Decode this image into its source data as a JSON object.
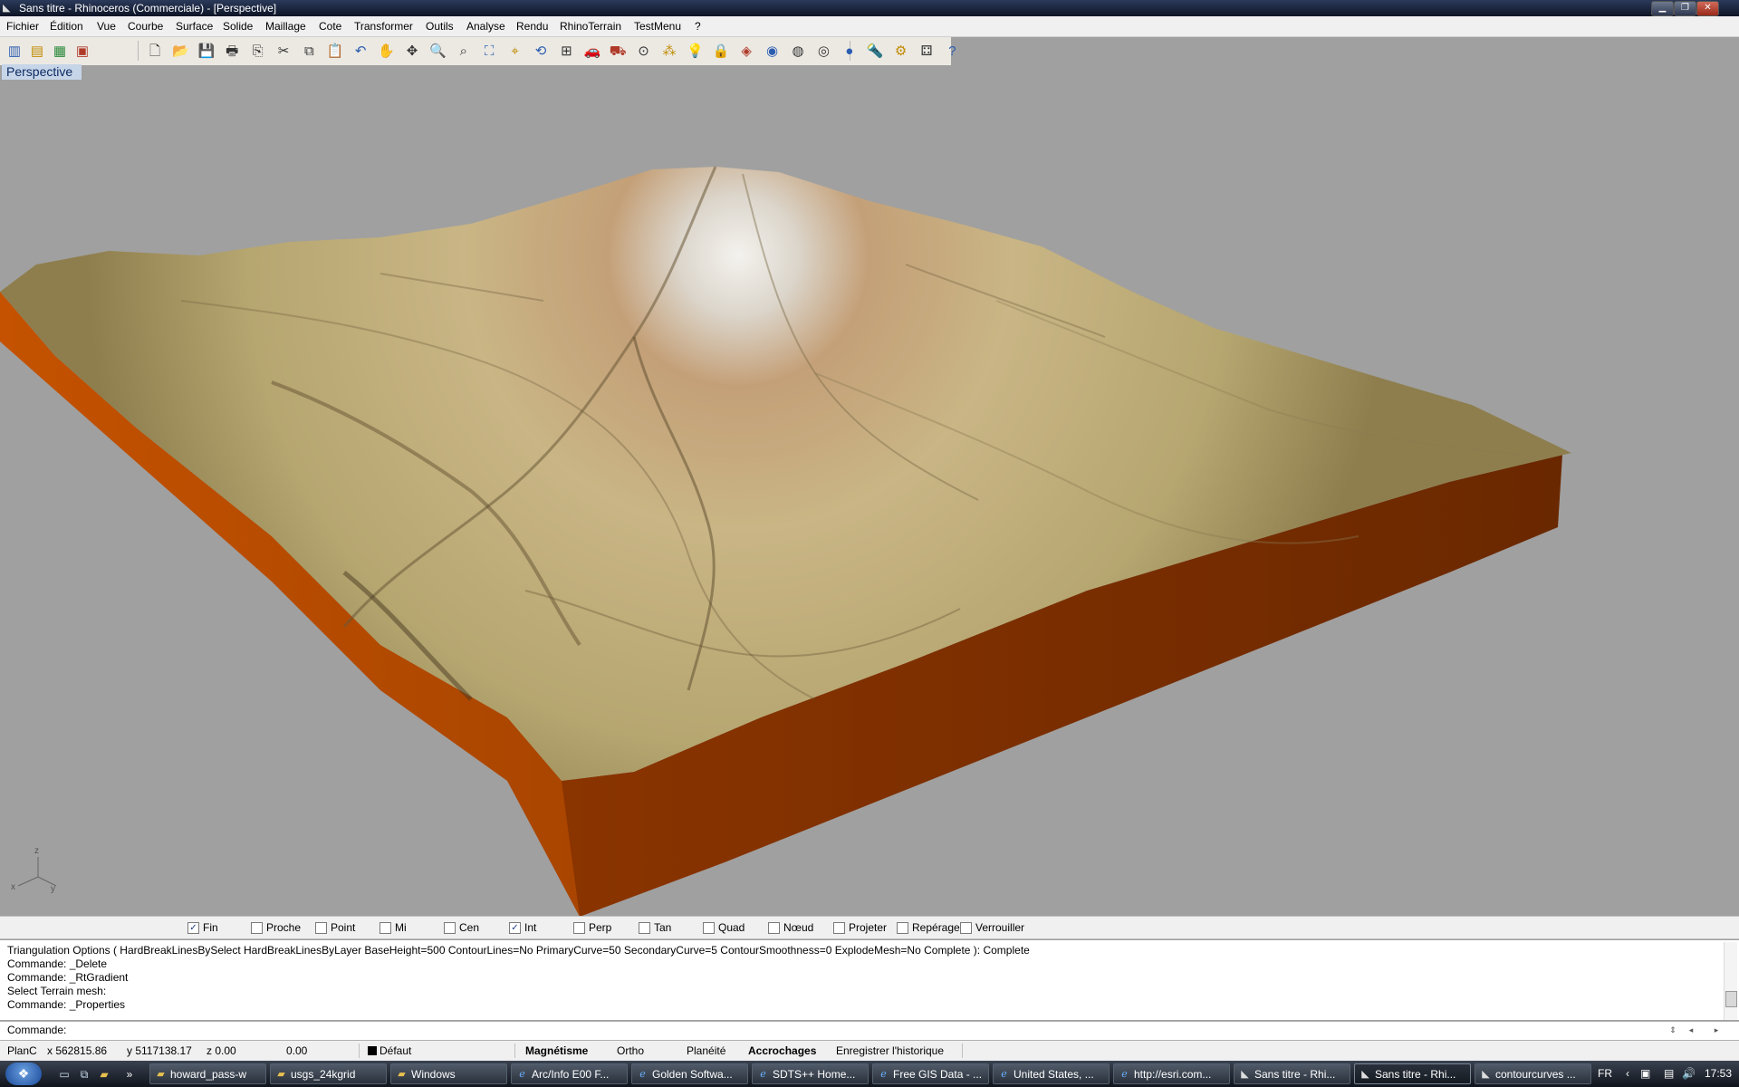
{
  "window": {
    "title": "Sans titre - Rhinoceros (Commerciale) - [Perspective]",
    "controls": [
      "▁",
      "❐",
      "✕"
    ]
  },
  "menu": [
    "Fichier",
    "Édition",
    "Vue",
    "Courbe",
    "Surface",
    "Solide",
    "Maillage",
    "Cote",
    "Transformer",
    "Outils",
    "Analyse",
    "Rendu",
    "RhinoTerrain",
    "TestMenu",
    "?"
  ],
  "toolbar_icons": [
    {
      "name": "terrain-chart-icon",
      "glyph": "▥"
    },
    {
      "name": "terrain-gradient-icon",
      "glyph": "▤"
    },
    {
      "name": "terrain-grid-icon",
      "glyph": "▦"
    },
    {
      "name": "terrain-jpg-icon",
      "glyph": "▣"
    },
    {
      "name": "new-file-icon",
      "glyph": "🗋"
    },
    {
      "name": "open-folder-icon",
      "glyph": "📂"
    },
    {
      "name": "save-icon",
      "glyph": "💾"
    },
    {
      "name": "print-icon",
      "glyph": "🖶"
    },
    {
      "name": "export-icon",
      "glyph": "⎘"
    },
    {
      "name": "cut-icon",
      "glyph": "✂"
    },
    {
      "name": "copy-icon",
      "glyph": "⧉"
    },
    {
      "name": "paste-icon",
      "glyph": "📋"
    },
    {
      "name": "undo-icon",
      "glyph": "↶"
    },
    {
      "name": "pan-hand-icon",
      "glyph": "✋"
    },
    {
      "name": "move-icon",
      "glyph": "✥"
    },
    {
      "name": "zoom-icon",
      "glyph": "🔍"
    },
    {
      "name": "zoom-window-icon",
      "glyph": "⌕"
    },
    {
      "name": "zoom-extents-icon",
      "glyph": "⛶"
    },
    {
      "name": "zoom-selected-icon",
      "glyph": "⌖"
    },
    {
      "name": "rotate-view-icon",
      "glyph": "⟲"
    },
    {
      "name": "four-viewports-icon",
      "glyph": "⊞"
    },
    {
      "name": "car-render-icon",
      "glyph": "🚗"
    },
    {
      "name": "car-wireframe-icon",
      "glyph": "⛟"
    },
    {
      "name": "select-icon",
      "glyph": "⊙"
    },
    {
      "name": "snap-points-icon",
      "glyph": "⁂"
    },
    {
      "name": "light-bulb-icon",
      "glyph": "💡"
    },
    {
      "name": "lock-icon",
      "glyph": "🔒"
    },
    {
      "name": "layer-icon",
      "glyph": "◈"
    },
    {
      "name": "color-wheel-icon",
      "glyph": "◉"
    },
    {
      "name": "wireframe-sphere-icon",
      "glyph": "◍"
    },
    {
      "name": "shaded-sphere-icon",
      "glyph": "◎"
    },
    {
      "name": "render-sphere-icon",
      "glyph": "●"
    },
    {
      "name": "flashlight-icon",
      "glyph": "🔦"
    },
    {
      "name": "options-gear-icon",
      "glyph": "⚙"
    },
    {
      "name": "properties-icon",
      "glyph": "⚃"
    },
    {
      "name": "help-icon",
      "glyph": "?"
    }
  ],
  "viewport": {
    "label": "Perspective",
    "axes": {
      "z": "z",
      "x": "x",
      "y": "y"
    },
    "colors": {
      "background": "#a0a0a0",
      "terrain_light": "#cbbf8c",
      "terrain_dark": "#6a5a38",
      "base": "#b54a00",
      "base_dark": "#6b2a00"
    }
  },
  "osnaps": [
    {
      "label": "Fin",
      "checked": true
    },
    {
      "label": "Proche",
      "checked": false
    },
    {
      "label": "Point",
      "checked": false
    },
    {
      "label": "Mi",
      "checked": false
    },
    {
      "label": "Cen",
      "checked": false
    },
    {
      "label": "Int",
      "checked": true
    },
    {
      "label": "Perp",
      "checked": false
    },
    {
      "label": "Tan",
      "checked": false
    },
    {
      "label": "Quad",
      "checked": false
    },
    {
      "label": "Nœud",
      "checked": false
    },
    {
      "label": "Projeter",
      "checked": false
    },
    {
      "label": "Repéragel",
      "checked": false
    },
    {
      "label": "Verrouiller",
      "checked": false
    }
  ],
  "history": [
    "Triangulation Options ( HardBreakLinesBySelect  HardBreakLinesByLayer  BaseHeight=500  ContourLines=No  PrimaryCurve=50  SecondaryCurve=5  ContourSmoothness=0  ExplodeMesh=No  Complete ): Complete",
    "Commande: _Delete",
    "Commande: _RtGradient",
    "Select Terrain mesh:",
    "Commande: _Properties"
  ],
  "command": {
    "label": "Commande:",
    "value": ""
  },
  "status": {
    "plane": "PlanC",
    "x": "x 562815.86",
    "y": "y 5117138.17",
    "z": "z 0.00",
    "dist": "0.00",
    "layer": "Défaut",
    "toggles": [
      "Magnétisme",
      "Ortho",
      "Planéité",
      "Accrochages",
      "Enregistrer l'historique"
    ],
    "bold_toggles": [
      "Magnétisme",
      "Accrochages"
    ]
  },
  "taskbar": {
    "quicklaunch": [
      "desktop-icon",
      "window-switch-icon",
      "folder-icon"
    ],
    "overflow": "»",
    "tasks": [
      {
        "label": "howard_pass-w",
        "icon": "folder-icon",
        "active": false
      },
      {
        "label": "usgs_24kgrid",
        "icon": "folder-icon",
        "active": false
      },
      {
        "label": "Windows",
        "icon": "folder-icon",
        "active": false
      },
      {
        "label": "Arc/Info E00 F...",
        "icon": "ie-icon",
        "active": false
      },
      {
        "label": "Golden Softwa...",
        "icon": "ie-icon",
        "active": false
      },
      {
        "label": "SDTS++ Home...",
        "icon": "ie-icon",
        "active": false
      },
      {
        "label": "Free GIS Data - ...",
        "icon": "ie-icon",
        "active": false
      },
      {
        "label": "United States, ...",
        "icon": "ie-icon",
        "active": false
      },
      {
        "label": "http://esri.com...",
        "icon": "ie-icon",
        "active": false
      },
      {
        "label": "Sans titre - Rhi...",
        "icon": "rhino-icon",
        "active": false
      },
      {
        "label": "Sans titre - Rhi...",
        "icon": "rhino-icon",
        "active": true
      },
      {
        "label": "contourcurves ...",
        "icon": "rhino-icon",
        "active": false
      }
    ],
    "language": "FR",
    "clock": "17:53"
  }
}
